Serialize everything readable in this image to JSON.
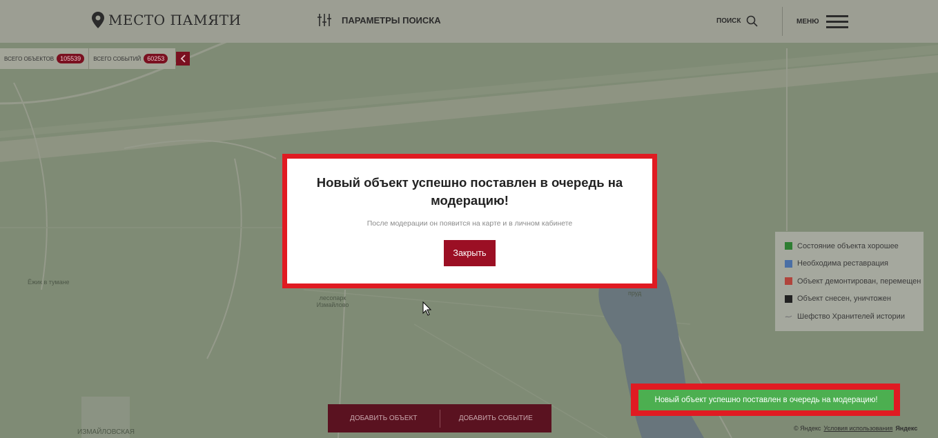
{
  "header": {
    "logo_text": "МЕСТО ПАМЯТИ",
    "search_params_label": "ПАРАМЕТРЫ ПОИСКА",
    "search_label": "ПОИСК",
    "menu_label": "МЕНЮ"
  },
  "stats": {
    "objects_label": "ВСЕГО ОБЪЕКТОВ",
    "objects_count": "105539",
    "events_label": "ВСЕГО СОБЫТИЙ",
    "events_count": "60253"
  },
  "map": {
    "labels": {
      "hedgehog": "Ёжик в тумане",
      "park": "лесопарк Измайлово",
      "pond": "пруд",
      "izmailovskaya": "ИЗМАЙЛОВСКАЯ"
    }
  },
  "legend": {
    "items": [
      {
        "label": "Состояние объекта хорошее",
        "color": "#2e7d32"
      },
      {
        "label": "Необходима реставрация",
        "color": "#4a6fa5"
      },
      {
        "label": "Объект демонтирован, перемещен",
        "color": "#b0443c"
      },
      {
        "label": "Объект снесен, уничтожен",
        "color": "#222222"
      },
      {
        "label": "Шефство Хранителей истории",
        "color": "#7a7a7a"
      }
    ]
  },
  "actions": {
    "add_object": "ДОБАВИТЬ ОБЪЕКТ",
    "add_event": "ДОБАВИТЬ СОБЫТИЕ"
  },
  "copyright": {
    "owner": "© Яндекс",
    "terms": "Условия использования",
    "brand": "Яндекс"
  },
  "modal": {
    "title": "Новый объект успешно поставлен в очередь на модерацию!",
    "subtitle": "После модерации он появится на карте и в личном кабинете",
    "close_label": "Закрыть"
  },
  "toast": {
    "message": "Новый объект успешно поставлен в очередь на модерацию!"
  },
  "colors": {
    "brand": "#9b0f24",
    "success": "#4caf50",
    "highlight": "#e01b22"
  }
}
